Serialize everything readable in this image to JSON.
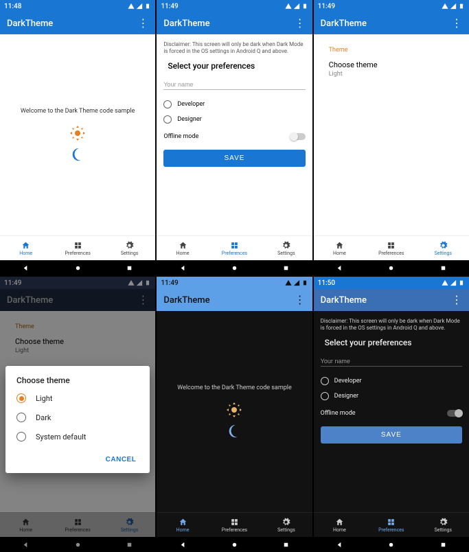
{
  "app_title": "DarkTheme",
  "screens": [
    {
      "time": "11:48",
      "nav": [
        "Home",
        "Preferences",
        "Settings"
      ],
      "active": 0
    },
    {
      "time": "11:49",
      "nav": [
        "Home",
        "Preferences",
        "Settings"
      ],
      "active": 1
    },
    {
      "time": "11:49",
      "nav": [
        "Home",
        "Preferences",
        "Settings"
      ],
      "active": 2
    },
    {
      "time": "11:49",
      "nav": [
        "Home",
        "Preferences",
        "Settings"
      ],
      "active": 2
    },
    {
      "time": "11:49",
      "nav": [
        "Home",
        "Preferences",
        "Settings"
      ],
      "active": 0
    },
    {
      "time": "11:50",
      "nav": [
        "Home",
        "Preferences",
        "Settings"
      ],
      "active": 1
    }
  ],
  "home": {
    "welcome": "Welcome to the Dark Theme code sample"
  },
  "prefs": {
    "disclaimer": "Disclaimer: This screen will only be dark when Dark Mode is forced in the OS settings in Android Q and above.",
    "title": "Select your preferences",
    "name_placeholder": "Your name",
    "role1": "Developer",
    "role2": "Designer",
    "offline": "Offline mode",
    "save": "SAVE"
  },
  "settings": {
    "section": "Theme",
    "choose": "Choose theme",
    "current": "Light"
  },
  "dialog": {
    "title": "Choose theme",
    "opt1": "Light",
    "opt2": "Dark",
    "opt3": "System default",
    "cancel": "CANCEL"
  }
}
